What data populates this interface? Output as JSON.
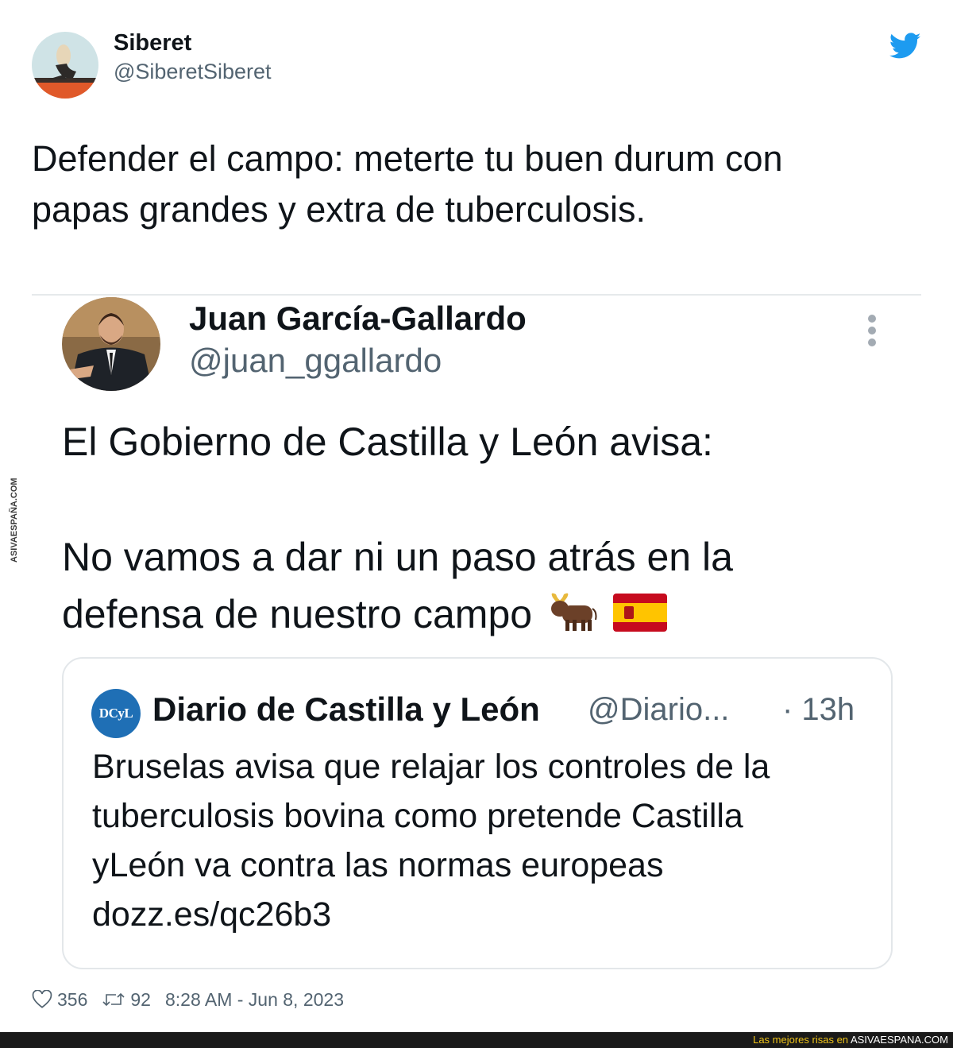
{
  "tweet": {
    "author_name": "Siberet",
    "author_handle": "@SiberetSiberet",
    "text_lines": [
      "Defender el campo: meterte tu buen durum con",
      "papas grandes y extra de tuberculosis."
    ],
    "likes": "356",
    "retweets": "92",
    "timestamp": "8:28 AM - Jun 8, 2023",
    "icon": "twitter-bird-icon",
    "accent_color": "#1d9bf0"
  },
  "quoted": {
    "author_name": "Juan García-Gallardo",
    "author_handle": "@juan_ggallardo",
    "line1": "El Gobierno de Castilla y León avisa:",
    "line2": "No vamos a dar ni un paso atrás en la",
    "line3": "defensa de nuestro campo",
    "emojis": [
      "bull-emoji",
      "spain-flag-emoji"
    ]
  },
  "embedded": {
    "logo_text": "DCyL",
    "author_name": "Diario de Castilla y León",
    "author_handle": "@Diario...",
    "time": "· 13h",
    "lines": [
      "Bruselas avisa que relajar los controles de la",
      "tuberculosis bovina como pretende Castilla",
      "yLeón va contra las normas europeas",
      "dozz.es/qc26b3"
    ]
  },
  "watermark": "ASIVAESPAÑA.COM",
  "footer": {
    "prefix": "Las mejores risas en ",
    "site": "ASIVAESPANA.COM"
  }
}
